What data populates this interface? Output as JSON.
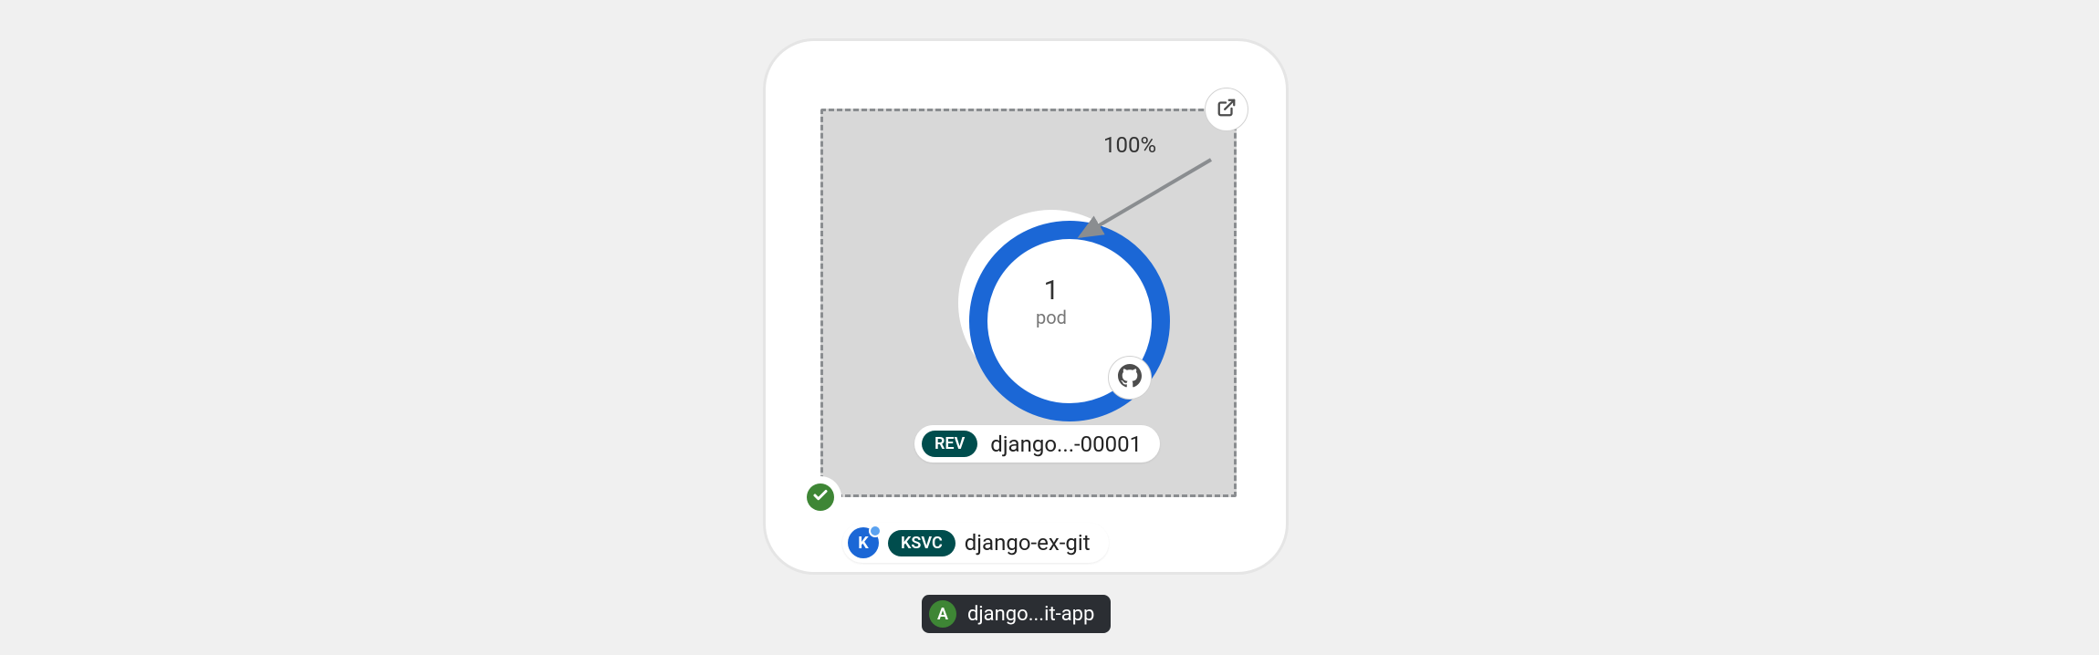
{
  "service": {
    "traffic_percent": "100%",
    "pod": {
      "count": "1",
      "unit": "pod"
    },
    "revision": {
      "badge": "REV",
      "name": "django...-00001"
    },
    "ksvc": {
      "badge": "KSVC",
      "name": "django-ex-git",
      "icon_letter": "K"
    },
    "status": "ready"
  },
  "app": {
    "icon_letter": "A",
    "name": "django...it-app"
  }
}
